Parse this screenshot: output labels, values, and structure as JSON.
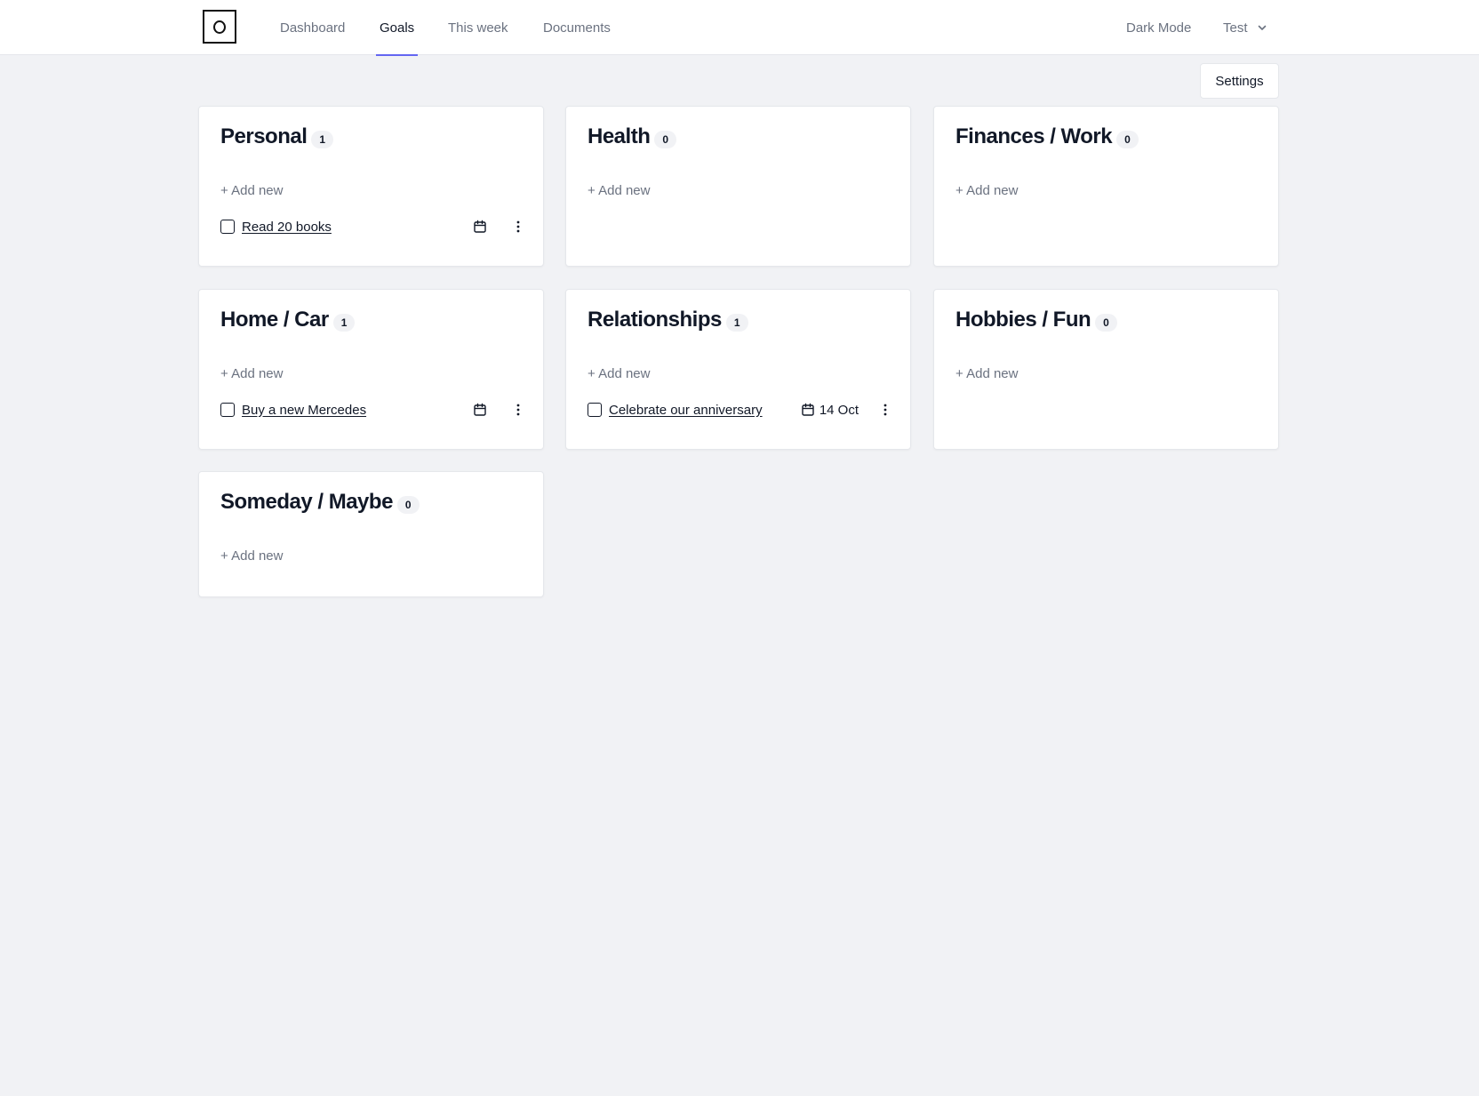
{
  "app": {
    "logo_letter": "O"
  },
  "nav": {
    "tabs": [
      {
        "label": "Dashboard",
        "active": false
      },
      {
        "label": "Goals",
        "active": true
      },
      {
        "label": "This week",
        "active": false
      },
      {
        "label": "Documents",
        "active": false
      }
    ],
    "dark_mode_label": "Dark Mode",
    "user_label": "Test",
    "accent_color": "#6366f1"
  },
  "toolbar": {
    "settings_label": "Settings"
  },
  "add_new_label": "+ Add new",
  "categories": [
    {
      "title": "Personal",
      "count": "1",
      "goals": [
        {
          "label": "Read 20 books",
          "date": ""
        }
      ]
    },
    {
      "title": "Health",
      "count": "0",
      "goals": []
    },
    {
      "title": "Finances / Work",
      "count": "0",
      "goals": []
    },
    {
      "title": "Home / Car",
      "count": "1",
      "goals": [
        {
          "label": "Buy a new Mercedes",
          "date": ""
        }
      ]
    },
    {
      "title": "Relationships",
      "count": "1",
      "goals": [
        {
          "label": "Celebrate our anniversary",
          "date": "14 Oct"
        }
      ]
    },
    {
      "title": "Hobbies / Fun",
      "count": "0",
      "goals": []
    },
    {
      "title": "Someday / Maybe",
      "count": "0",
      "goals": []
    }
  ],
  "icons": {
    "calendar": "calendar-icon",
    "more": "more-vertical-icon",
    "chevron": "chevron-down-icon"
  }
}
